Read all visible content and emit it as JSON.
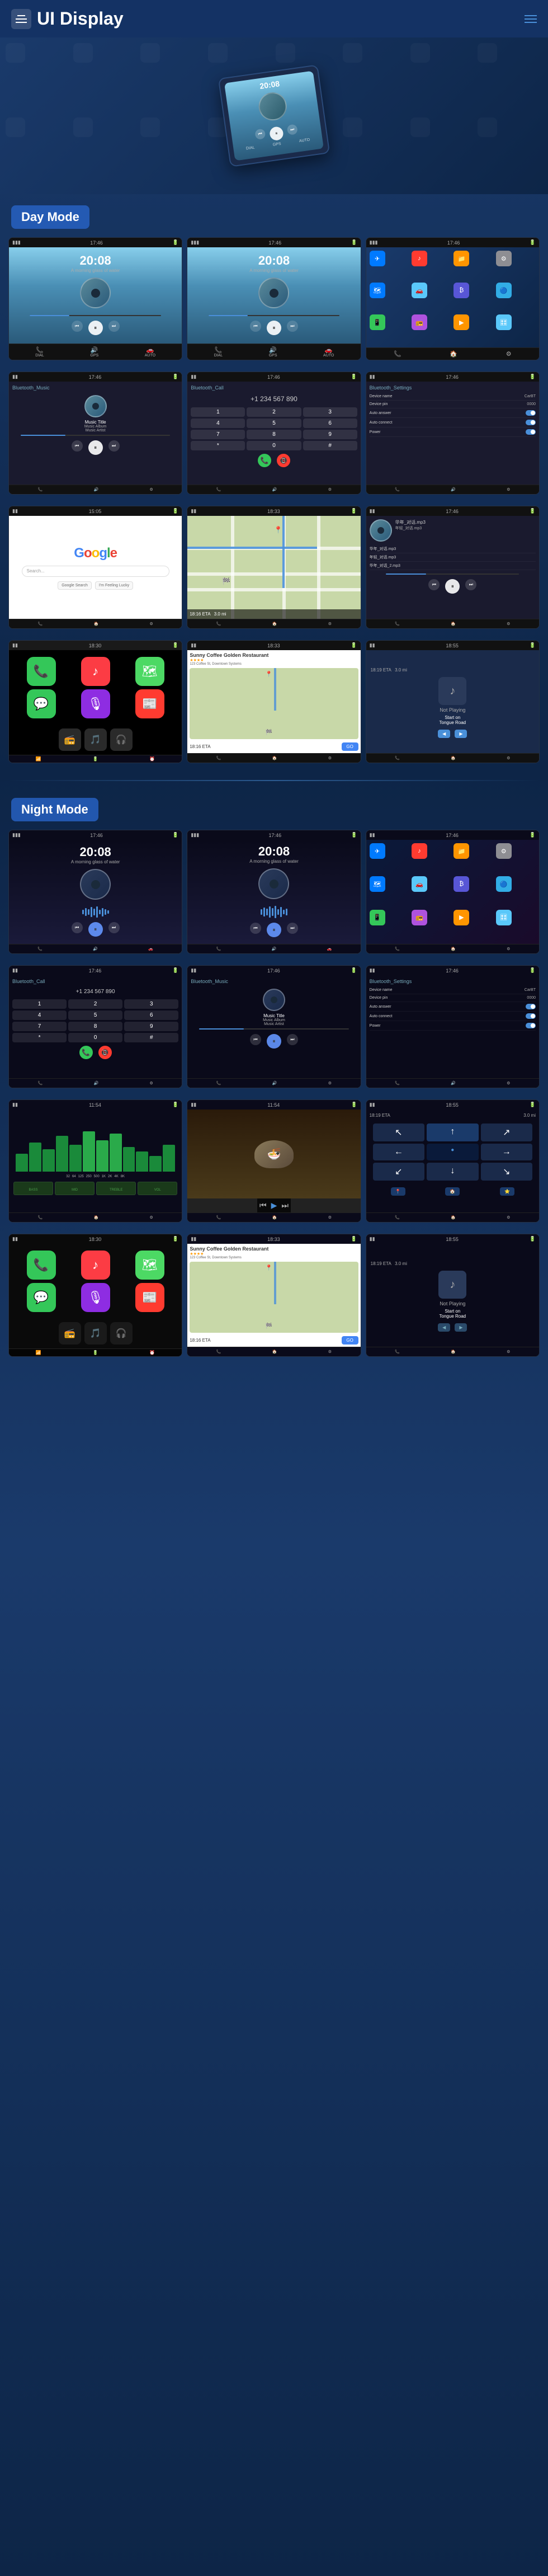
{
  "header": {
    "title": "UI Display",
    "menu_icon": "menu-icon",
    "hamburger_icon": "hamburger-icon"
  },
  "hero": {
    "device_time": "20:08"
  },
  "day_mode": {
    "label": "Day Mode",
    "screens": [
      {
        "id": "day-music-1",
        "type": "music",
        "time": "20:08",
        "subtitle": "A morning glass of water"
      },
      {
        "id": "day-music-2",
        "type": "music",
        "time": "20:08",
        "subtitle": "A morning glass of water"
      },
      {
        "id": "day-home",
        "type": "home"
      },
      {
        "id": "day-bt-music",
        "type": "bluetooth_music",
        "title": "Bluetooth_Music",
        "track": "Music Title",
        "album": "Music Album",
        "artist": "Music Artist"
      },
      {
        "id": "day-bt-call",
        "type": "bluetooth_call",
        "title": "Bluetooth_Call"
      },
      {
        "id": "day-settings",
        "type": "settings",
        "title": "Bluetooth_Settings"
      },
      {
        "id": "day-google",
        "type": "google"
      },
      {
        "id": "day-map",
        "type": "map"
      },
      {
        "id": "day-local",
        "type": "local_music"
      },
      {
        "id": "day-carplay",
        "type": "carplay"
      },
      {
        "id": "day-coffee",
        "type": "coffee"
      },
      {
        "id": "day-notplaying",
        "type": "notplaying"
      }
    ]
  },
  "night_mode": {
    "label": "Night Mode",
    "screens": [
      {
        "id": "night-music-1",
        "type": "night_music",
        "time": "20:08"
      },
      {
        "id": "night-music-2",
        "type": "night_music",
        "time": "20:08"
      },
      {
        "id": "night-home",
        "type": "night_home"
      },
      {
        "id": "night-bt-call",
        "type": "night_bt_call",
        "title": "Bluetooth_Call"
      },
      {
        "id": "night-bt-music",
        "type": "night_bt_music",
        "title": "Bluetooth_Music",
        "track": "Music Title",
        "album": "Music Album",
        "artist": "Music Artist"
      },
      {
        "id": "night-settings",
        "type": "night_settings"
      },
      {
        "id": "night-wave",
        "type": "night_wave"
      },
      {
        "id": "night-photo",
        "type": "night_photo"
      },
      {
        "id": "night-nav",
        "type": "night_nav"
      },
      {
        "id": "night-carplay",
        "type": "night_carplay"
      },
      {
        "id": "night-coffee",
        "type": "night_coffee"
      },
      {
        "id": "night-notplaying",
        "type": "night_notplaying"
      }
    ]
  },
  "settings": {
    "device_name_label": "Device name",
    "device_name_val": "CarBT",
    "device_pin_label": "Device pin",
    "device_pin_val": "0000",
    "auto_answer_label": "Auto answer",
    "auto_connect_label": "Auto connect",
    "power_label": "Power"
  },
  "nav_items": [
    "DIAL",
    "⚡",
    "GPS",
    "AUTO"
  ],
  "track_info": {
    "title": "Music Title",
    "album": "Music Album",
    "artist": "Music Artist"
  },
  "map_info": {
    "eta": "18:16 ETA",
    "distance": "3.0 mi",
    "road": "Start on Tongue Road"
  },
  "coffee_shop": {
    "name": "Sunny Coffee Golden Restaurant",
    "rating": "★★★★",
    "address": "123 Coffee St, Downtown Systems",
    "go_label": "GO"
  }
}
